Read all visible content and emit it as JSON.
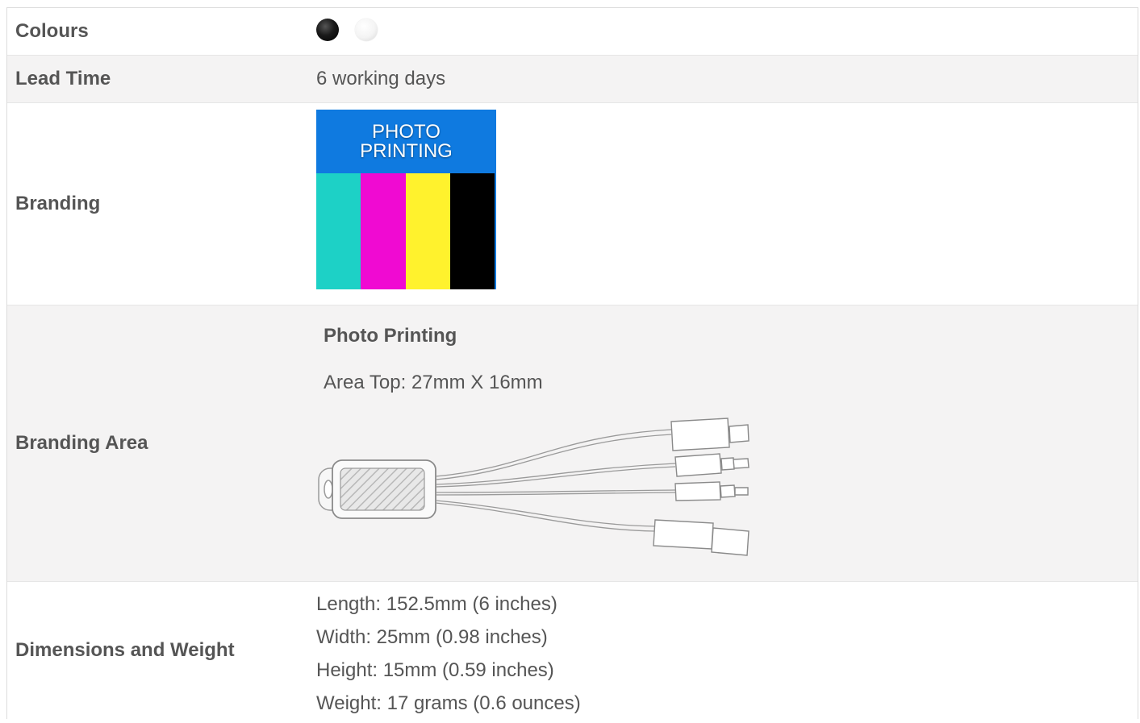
{
  "rows": {
    "colours": {
      "label": "Colours",
      "swatches": [
        "#000000",
        "#ffffff"
      ]
    },
    "lead_time": {
      "label": "Lead Time",
      "value": "6 working days"
    },
    "branding": {
      "label": "Branding",
      "tile_line1": "PHOTO",
      "tile_line2": "PRINTING",
      "tile_bg": "#0f7ae0",
      "bar_colors": [
        "#1dd1c6",
        "#f00ad2",
        "#fff22d",
        "#000000"
      ]
    },
    "branding_area": {
      "label": "Branding Area",
      "method": "Photo Printing",
      "area": "Area Top: 27mm X 16mm",
      "image_icon": "multi-usb-cable-drawing-icon"
    },
    "dimensions": {
      "label": "Dimensions and Weight",
      "lines": [
        "Length: 152.5mm (6 inches)",
        "Width: 25mm (0.98 inches)",
        "Height: 15mm (0.59 inches)",
        "Weight: 17 grams (0.6 ounces)"
      ]
    }
  }
}
